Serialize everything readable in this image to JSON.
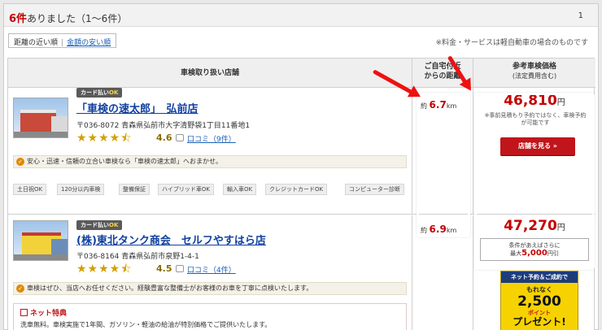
{
  "result": {
    "count": "6件",
    "suffix": "ありました（1～6件）",
    "page": "1"
  },
  "sort": {
    "active": "距離の近い順",
    "separator": "|",
    "link": "金額の安い順",
    "note": "※料金・サービスは軽自動車の場合のものです"
  },
  "table": {
    "header_store": "車検取り扱い店舗",
    "header_distance_1": "ご自宅付近",
    "header_distance_2": "からの距離",
    "header_price_1": "参考車検価格",
    "header_price_2": "(法定費用含む)"
  },
  "stores": [
    {
      "badge_prefix": "カード払い",
      "badge_ok": "OK",
      "name": "「車検の速太郎」　弘前店",
      "address": "〒036-8072 青森県弘前市大字清野袋1丁目11番地1",
      "stars": "★★★★⯪",
      "rating": "4.6",
      "review": "口コミ（9件）",
      "message": "安心・迅速・信頼の立合い車検なら「車検の速太郎」へおまかせ。",
      "tags": [
        "土日祝OK",
        "120分以内車検",
        "整備保証",
        "ハイブリッド車OK",
        "輸入車OK",
        "クレジットカードOK",
        "コンピューター診断"
      ],
      "distance_prefix": "約",
      "distance_value": "6.7",
      "distance_unit": "km",
      "price": "46,810",
      "yen": "円",
      "price_note": "※事前見積もり予約ではなく、車検予約が可能です",
      "button": "店舗を見る »"
    },
    {
      "badge_prefix": "カード払い",
      "badge_ok": "OK",
      "name": "(株)東北タンク商会　セルフやすはら店",
      "address": "〒036-8164 青森県弘前市泉野1-4-1",
      "stars": "★★★★⯪",
      "rating": "4.5",
      "review": "口コミ（4件）",
      "message": "車検はぜひ、当店へお任せください。経験豊富な整備士がお客様のお車を丁寧に点検いたします。",
      "distance_prefix": "約",
      "distance_value": "6.9",
      "distance_unit": "km",
      "price": "47,270",
      "yen": "円",
      "cond_line1": "条件があえばさらに",
      "cond_prefix": "最大",
      "cond_amount": "5,000",
      "cond_suffix": "円引",
      "net_title": "ネット特典",
      "net_text": "洗車無料。車検実施で1年間、ガソリン・軽油の給油が特別価格でご提供いたします。",
      "promo_head": "ネット予約＆ご成約で",
      "promo_l1": "もれなく",
      "promo_big": "2,500",
      "promo_pt": "ポイント",
      "promo_gift": "プレゼント!"
    }
  ],
  "colors": {
    "accent_red": "#c40000",
    "link_blue": "#1a5fb4",
    "button_red": "#c0151b",
    "arrow": "#ee1111"
  }
}
